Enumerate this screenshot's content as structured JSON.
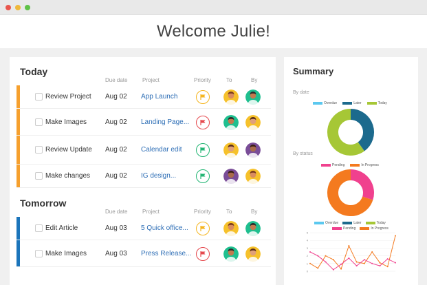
{
  "header": {
    "welcome": "Welcome Julie!"
  },
  "colors": {
    "orange": "#f6a02e",
    "blue": "#1b75bb",
    "yellow": "#f5b51f",
    "red": "#e5484d",
    "green": "#22b573",
    "link": "#2c6db5"
  },
  "columns": {
    "due": "Due date",
    "project": "Project",
    "priority": "Priority",
    "to": "To",
    "by": "By"
  },
  "today": {
    "title": "Today",
    "tasks": [
      {
        "name": "Review Project",
        "due": "Aug 02",
        "project": "App Launch",
        "priority": "yellow"
      },
      {
        "name": "Make Images",
        "due": "Aug 02",
        "project": "Landing Page...",
        "priority": "red"
      },
      {
        "name": "Review Update",
        "due": "Aug 02",
        "project": "Calendar edit",
        "priority": "green"
      },
      {
        "name": "Make changes",
        "due": "Aug 02",
        "project": "IG design...",
        "priority": "green"
      }
    ]
  },
  "tomorrow": {
    "title": "Tomorrow",
    "tasks": [
      {
        "name": "Edit Article",
        "due": "Aug 03",
        "project": "5 Quick office...",
        "priority": "yellow"
      },
      {
        "name": "Make Images",
        "due": "Aug 03",
        "project": "Press Release...",
        "priority": "red"
      }
    ]
  },
  "summary": {
    "title": "Summary",
    "by_date_label": "By date",
    "by_status_label": "By status",
    "legend_date": [
      "Overdue",
      "Later",
      "Today"
    ],
    "legend_status": [
      "Pending",
      "In Progress"
    ]
  },
  "chart_data": [
    {
      "type": "pie",
      "categories": [
        "Overdue",
        "Later",
        "Today"
      ],
      "values": [
        0,
        40,
        60
      ],
      "colors": [
        "#5bc8ef",
        "#1c6a8d",
        "#a6c736"
      ]
    },
    {
      "type": "pie",
      "categories": [
        "Pending",
        "In Progress"
      ],
      "values": [
        30,
        70
      ],
      "colors": [
        "#f0418e",
        "#f47a1f"
      ]
    },
    {
      "type": "line",
      "categories": [
        "Overdue",
        "Later",
        "Today",
        "Pending",
        "In Progress"
      ],
      "x": [
        1,
        2,
        3,
        4,
        5,
        6,
        7,
        8,
        9,
        10,
        11,
        12
      ],
      "ylim": [
        0,
        5
      ],
      "yticks": [
        "0",
        "1",
        "2",
        "3",
        "4",
        "5"
      ],
      "series": [
        {
          "name": "In Progress",
          "color": "#f47a1f",
          "values": [
            1,
            0.4,
            2,
            1.5,
            0.3,
            3.3,
            1.2,
            1.0,
            2.5,
            1.1,
            0.6,
            4.6
          ]
        },
        {
          "name": "Pending",
          "color": "#f0418e",
          "values": [
            2.5,
            2,
            1.2,
            0.2,
            0.9,
            1.7,
            0.7,
            1.5,
            1.0,
            0.7,
            1.6,
            1.1
          ]
        }
      ]
    }
  ]
}
